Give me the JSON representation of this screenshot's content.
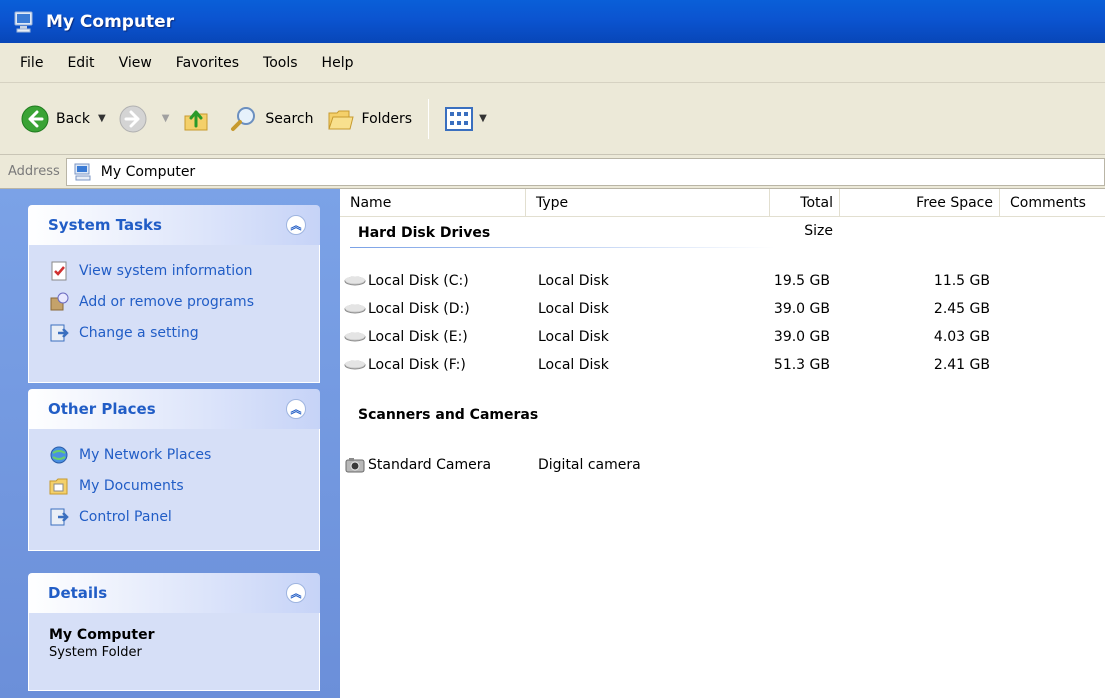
{
  "window": {
    "title": "My Computer"
  },
  "menu": [
    "File",
    "Edit",
    "View",
    "Favorites",
    "Tools",
    "Help"
  ],
  "toolbar": {
    "back_label": "Back",
    "search_label": "Search",
    "folders_label": "Folders"
  },
  "address": {
    "label": "Address",
    "value": "My Computer"
  },
  "task_pane": {
    "system_tasks": {
      "title": "System Tasks",
      "items": [
        "View system information",
        "Add or remove programs",
        "Change a setting"
      ]
    },
    "other_places": {
      "title": "Other Places",
      "items": [
        "My Network Places",
        "My Documents",
        "Control Panel"
      ]
    },
    "details": {
      "title": "Details",
      "name": "My Computer",
      "kind": "System Folder"
    }
  },
  "columns": [
    "Name",
    "Type",
    "Total Size",
    "Free Space",
    "Comments"
  ],
  "groups": {
    "hard_disks": {
      "title": "Hard Disk Drives",
      "rows": [
        {
          "name": "Local Disk (C:)",
          "type": "Local Disk",
          "total": "19.5 GB",
          "free": "11.5 GB"
        },
        {
          "name": "Local Disk (D:)",
          "type": "Local Disk",
          "total": "39.0 GB",
          "free": "2.45 GB"
        },
        {
          "name": "Local Disk (E:)",
          "type": "Local Disk",
          "total": "39.0 GB",
          "free": "4.03 GB"
        },
        {
          "name": "Local Disk (F:)",
          "type": "Local Disk",
          "total": "51.3 GB",
          "free": "2.41 GB"
        }
      ]
    },
    "scanners": {
      "title": "Scanners and Cameras",
      "rows": [
        {
          "name": "Standard Camera",
          "type": "Digital camera"
        }
      ]
    }
  },
  "colors": {
    "title_bar": "#0b54d0",
    "task_pane": "#7ba2e7",
    "link": "#215dc6"
  }
}
